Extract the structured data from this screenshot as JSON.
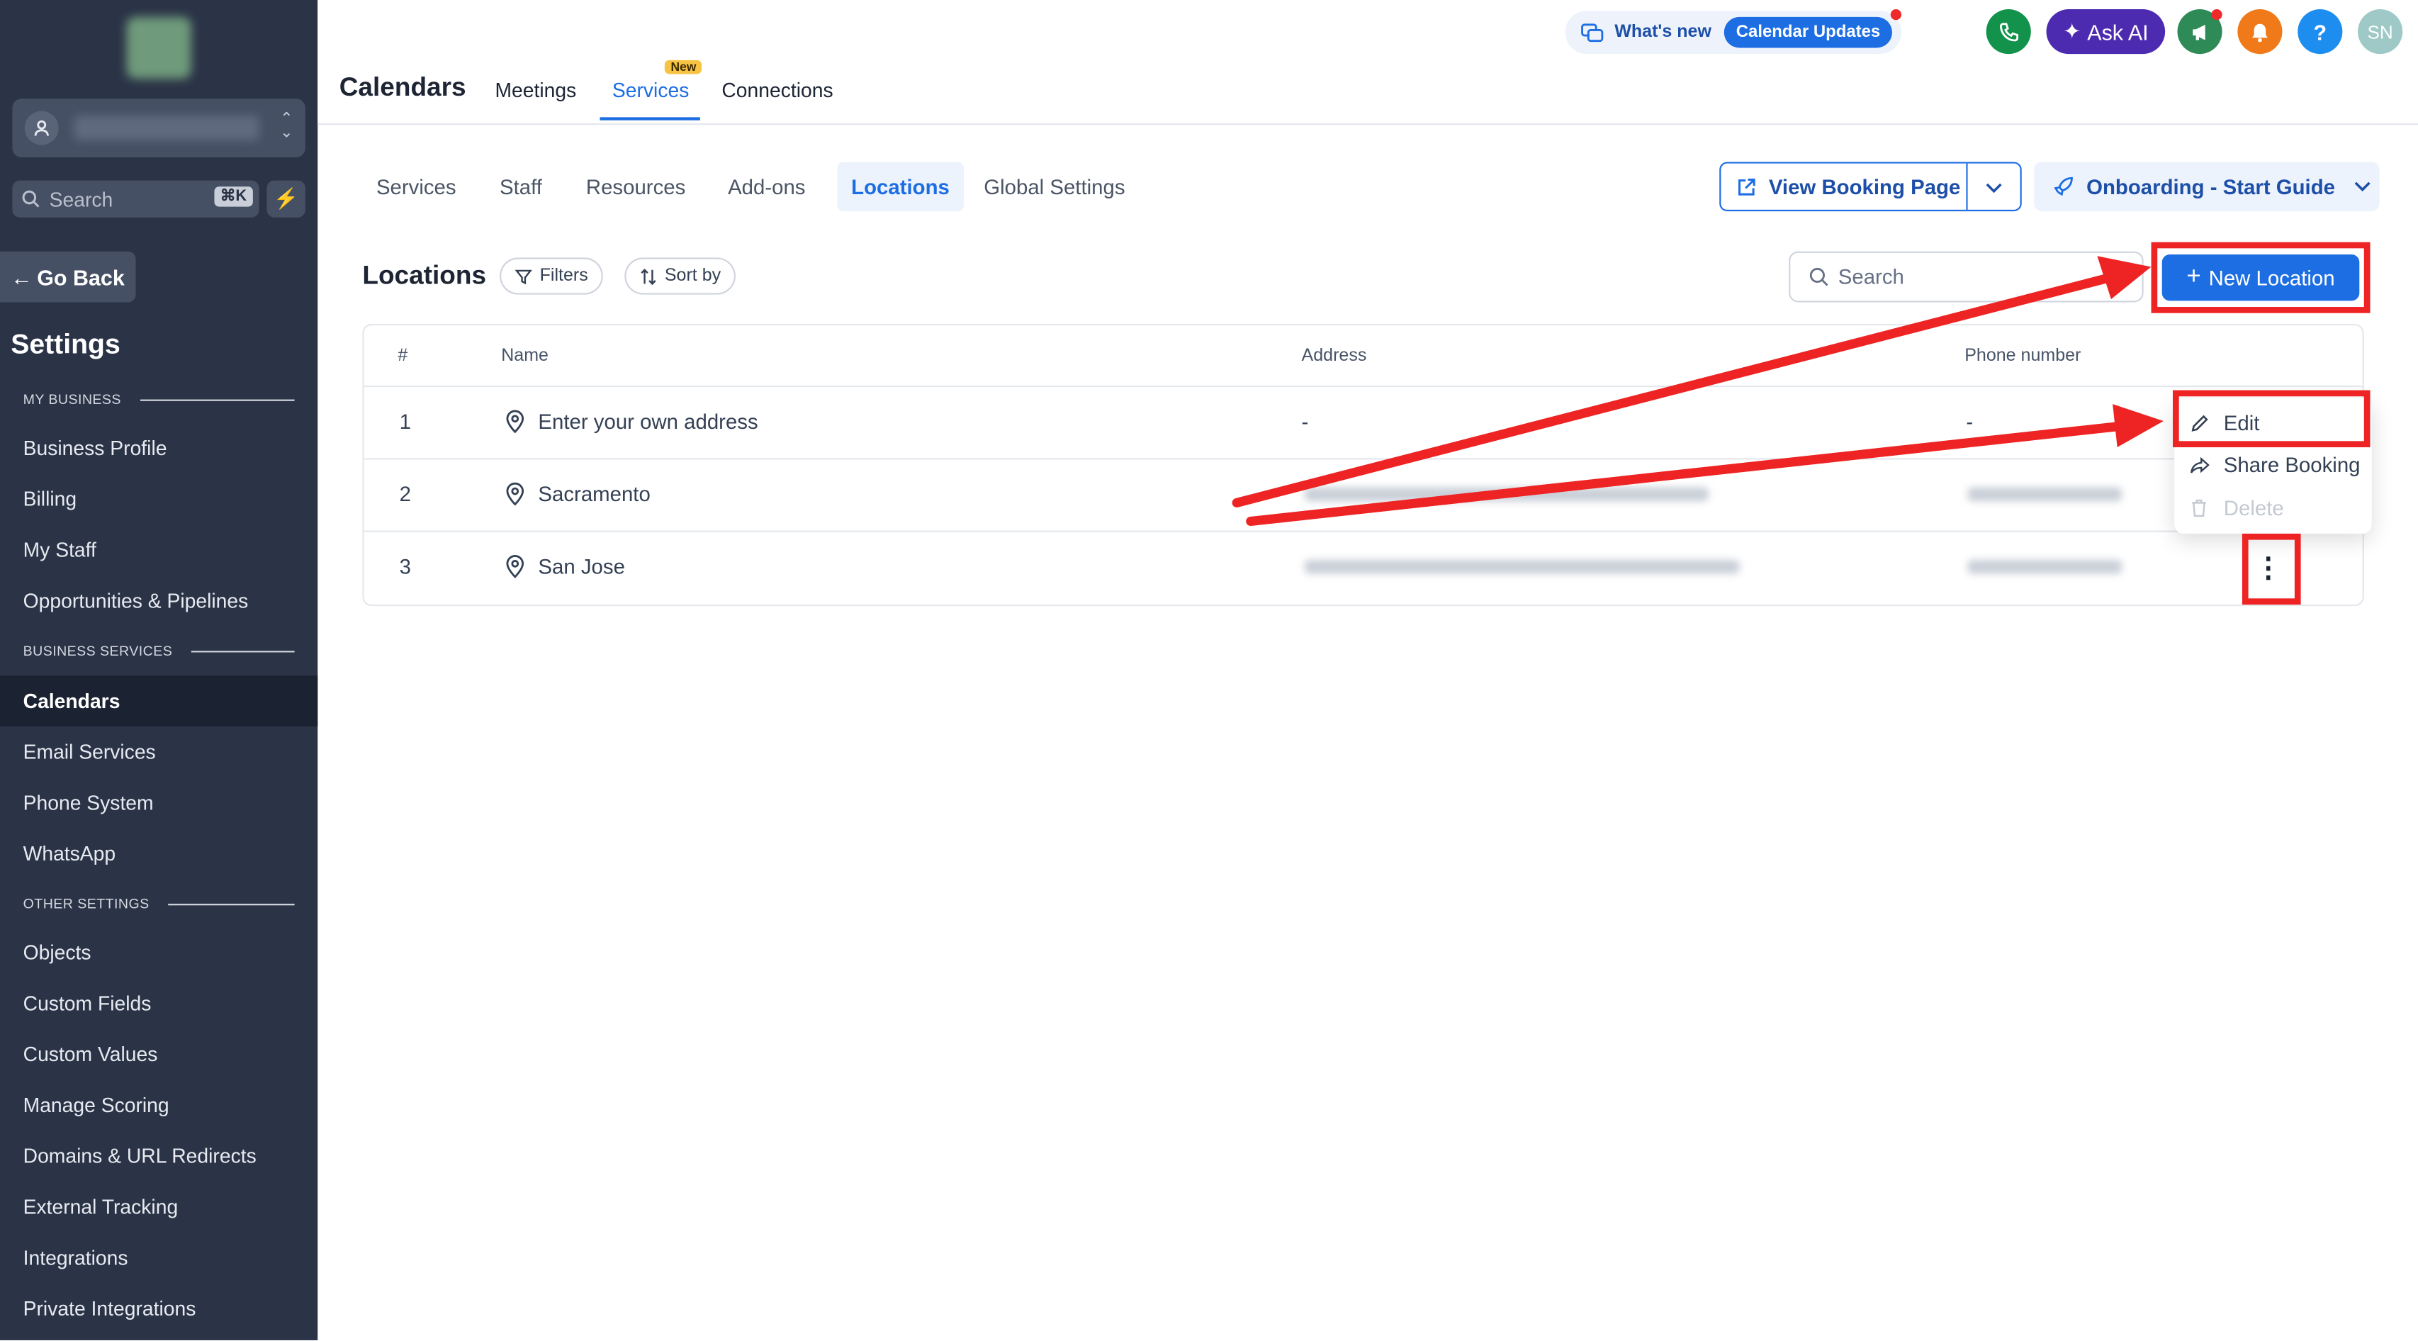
{
  "sidebar": {
    "search_placeholder": "Search",
    "search_shortcut": "⌘K",
    "go_back": "Go Back",
    "title": "Settings",
    "sections": {
      "my_business": "MY BUSINESS",
      "business_services": "BUSINESS SERVICES",
      "other_settings": "OTHER SETTINGS"
    },
    "items": [
      {
        "label": "Business Profile"
      },
      {
        "label": "Billing"
      },
      {
        "label": "My Staff"
      },
      {
        "label": "Opportunities & Pipelines"
      },
      {
        "label": "Calendars"
      },
      {
        "label": "Email Services"
      },
      {
        "label": "Phone System"
      },
      {
        "label": "WhatsApp"
      },
      {
        "label": "Objects"
      },
      {
        "label": "Custom Fields"
      },
      {
        "label": "Custom Values"
      },
      {
        "label": "Manage Scoring"
      },
      {
        "label": "Domains & URL Redirects"
      },
      {
        "label": "External Tracking"
      },
      {
        "label": "Integrations"
      },
      {
        "label": "Private Integrations"
      }
    ],
    "active_item": "Calendars"
  },
  "header": {
    "title": "Calendars",
    "tabs": [
      {
        "label": "Meetings"
      },
      {
        "label": "Services",
        "badge": "New"
      },
      {
        "label": "Connections"
      }
    ],
    "active_tab": "Services",
    "whats_new": "What's new",
    "calendar_updates": "Calendar Updates",
    "ask_ai": "Ask AI",
    "help": "?",
    "avatar_initials": "SN"
  },
  "subtabs": {
    "items": [
      {
        "label": "Services"
      },
      {
        "label": "Staff"
      },
      {
        "label": "Resources"
      },
      {
        "label": "Add-ons"
      },
      {
        "label": "Locations"
      },
      {
        "label": "Global Settings"
      }
    ],
    "active": "Locations",
    "view_booking_page": "View Booking Page",
    "onboarding": "Onboarding - Start Guide"
  },
  "locations": {
    "title": "Locations",
    "filters": "Filters",
    "sort_by": "Sort by",
    "search_placeholder": "Search",
    "new_location": "New Location",
    "columns": [
      "#",
      "Name",
      "Address",
      "Phone number"
    ],
    "rows": [
      {
        "num": "1",
        "name": "Enter your own address",
        "address": "-",
        "phone": "-"
      },
      {
        "num": "2",
        "name": "Sacramento",
        "address": "",
        "phone": ""
      },
      {
        "num": "3",
        "name": "San Jose",
        "address": "",
        "phone": ""
      }
    ]
  },
  "row_menu": {
    "edit": "Edit",
    "share_booking": "Share Booking",
    "delete": "Delete"
  },
  "colors": {
    "sidebar_bg": "#2b3447",
    "accent": "#1d6ee3",
    "annotation_red": "#ee2424"
  }
}
